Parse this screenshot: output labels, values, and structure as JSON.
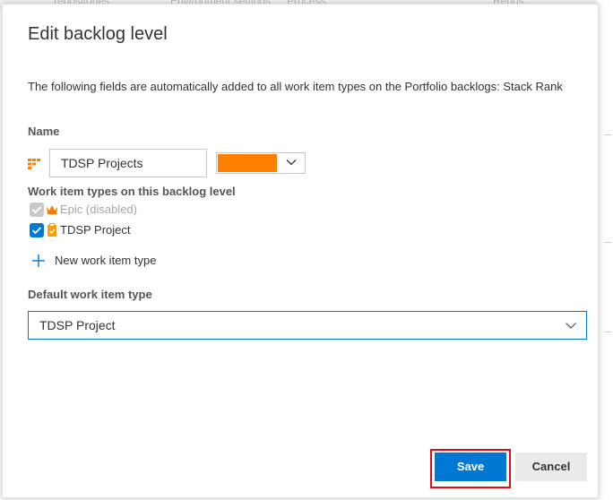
{
  "background_fragments": [
    "repositories",
    "Environment settings",
    "Process",
    "Repos"
  ],
  "dialog": {
    "title": "Edit backlog level",
    "info_text": "The following fields are automatically added to all work item types on the Portfolio backlogs: Stack Rank",
    "name_label": "Name",
    "name_value": "TDSP Projects",
    "color_value": "#ff7f00",
    "wit_label": "Work item types on this backlog level",
    "work_item_types": [
      {
        "label": "Epic (disabled)",
        "checked": true,
        "disabled": true,
        "icon": "crown-icon",
        "icon_color": "#ff7b00"
      },
      {
        "label": "TDSP Project",
        "checked": true,
        "disabled": false,
        "icon": "clipboard-icon",
        "icon_color": "#ff9d00"
      }
    ],
    "new_wit_label": "New work item type",
    "default_label": "Default work item type",
    "default_value": "TDSP Project",
    "save_label": "Save",
    "cancel_label": "Cancel"
  },
  "colors": {
    "accent": "#0078d4",
    "highlight": "#e00b1c",
    "backlog_icon": "#ff7f00"
  }
}
